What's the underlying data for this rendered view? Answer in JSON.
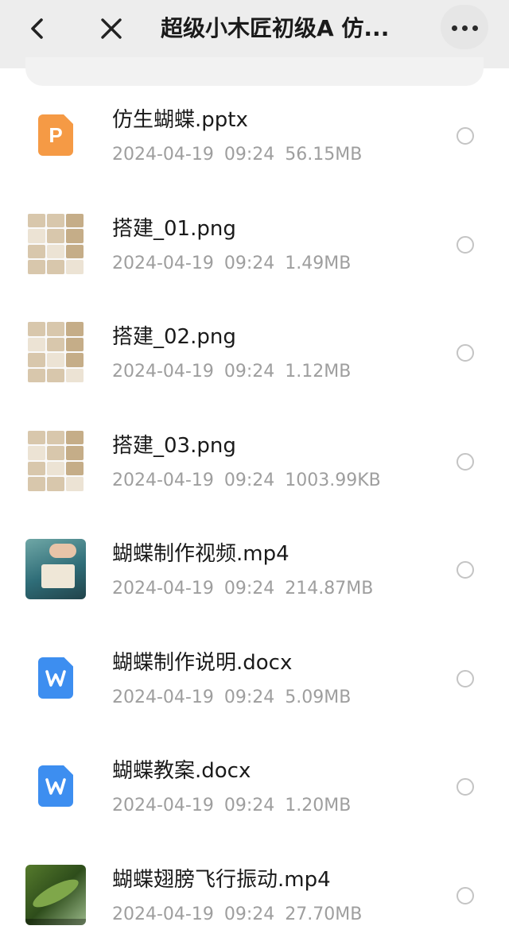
{
  "header": {
    "title": "超级小木匠初级A 仿...",
    "back_icon": "chevron-left-icon",
    "close_icon": "close-icon",
    "more_icon": "more-horizontal-icon"
  },
  "files": [
    {
      "name": "仿生蝴蝶.pptx",
      "date": "2024-04-19",
      "time": "09:24",
      "size": "56.15MB",
      "icon": "ppt",
      "icon_letter": "P"
    },
    {
      "name": "搭建_01.png",
      "date": "2024-04-19",
      "time": "09:24",
      "size": "1.49MB",
      "icon": "image"
    },
    {
      "name": "搭建_02.png",
      "date": "2024-04-19",
      "time": "09:24",
      "size": "1.12MB",
      "icon": "image"
    },
    {
      "name": "搭建_03.png",
      "date": "2024-04-19",
      "time": "09:24",
      "size": "1003.99KB",
      "icon": "image"
    },
    {
      "name": "蝴蝶制作视频.mp4",
      "date": "2024-04-19",
      "time": "09:24",
      "size": "214.87MB",
      "icon": "video"
    },
    {
      "name": "蝴蝶制作说明.docx",
      "date": "2024-04-19",
      "time": "09:24",
      "size": "5.09MB",
      "icon": "word",
      "icon_letter": "W"
    },
    {
      "name": "蝴蝶教案.docx",
      "date": "2024-04-19",
      "time": "09:24",
      "size": "1.20MB",
      "icon": "word",
      "icon_letter": "W"
    },
    {
      "name": "蝴蝶翅膀飞行振动.mp4",
      "date": "2024-04-19",
      "time": "09:24",
      "size": "27.70MB",
      "icon": "video"
    }
  ],
  "colors": {
    "header_bg": "#ededed",
    "ppt_orange": "#f59a45",
    "word_blue": "#3d8ef0",
    "meta_gray": "#9e9e9e"
  }
}
